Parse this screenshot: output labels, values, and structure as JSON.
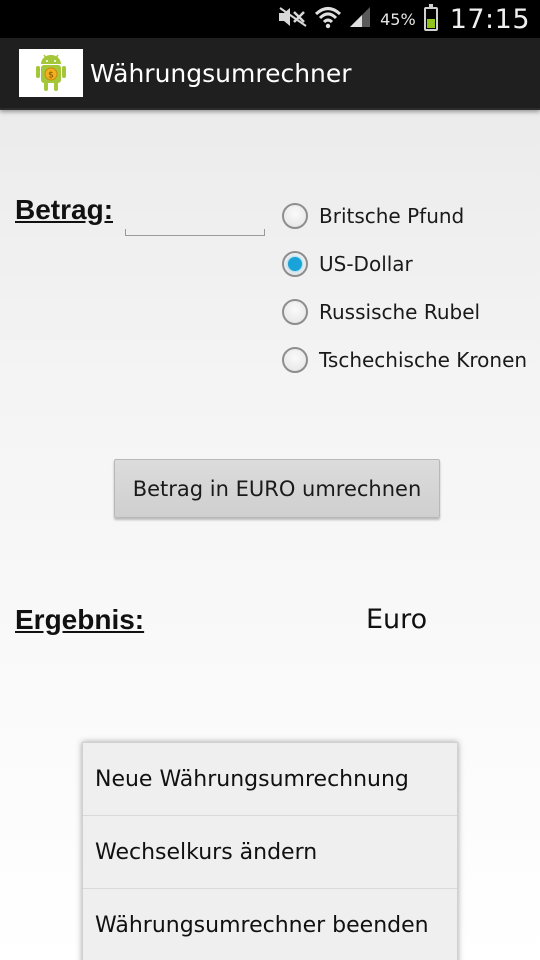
{
  "status_bar": {
    "battery_percent": "45%",
    "battery_level": 0.45,
    "time": "17:15",
    "icons": [
      "mute-icon",
      "wifi-icon",
      "signal-icon",
      "battery-icon"
    ],
    "battery_color": "#8fc21a"
  },
  "action_bar": {
    "app_icon": "android-currency-icon",
    "title": "Währungsumrechner"
  },
  "form": {
    "amount_label": "Betrag:",
    "amount_value": "",
    "currencies": [
      {
        "label": "Britsche Pfund",
        "selected": false
      },
      {
        "label": "US-Dollar",
        "selected": true
      },
      {
        "label": "Russische Rubel",
        "selected": false
      },
      {
        "label": "Tschechische Kronen",
        "selected": false
      }
    ],
    "radio_selected_color": "#1aa3d8",
    "convert_button_label": "Betrag in EURO umrechnen",
    "result_label": "Ergebnis:",
    "result_value": "Euro"
  },
  "options_menu": {
    "items": [
      {
        "label": "Neue Währungsumrechnung"
      },
      {
        "label": "Wechselkurs ändern"
      },
      {
        "label": "Währungsumrechner beenden"
      }
    ]
  }
}
